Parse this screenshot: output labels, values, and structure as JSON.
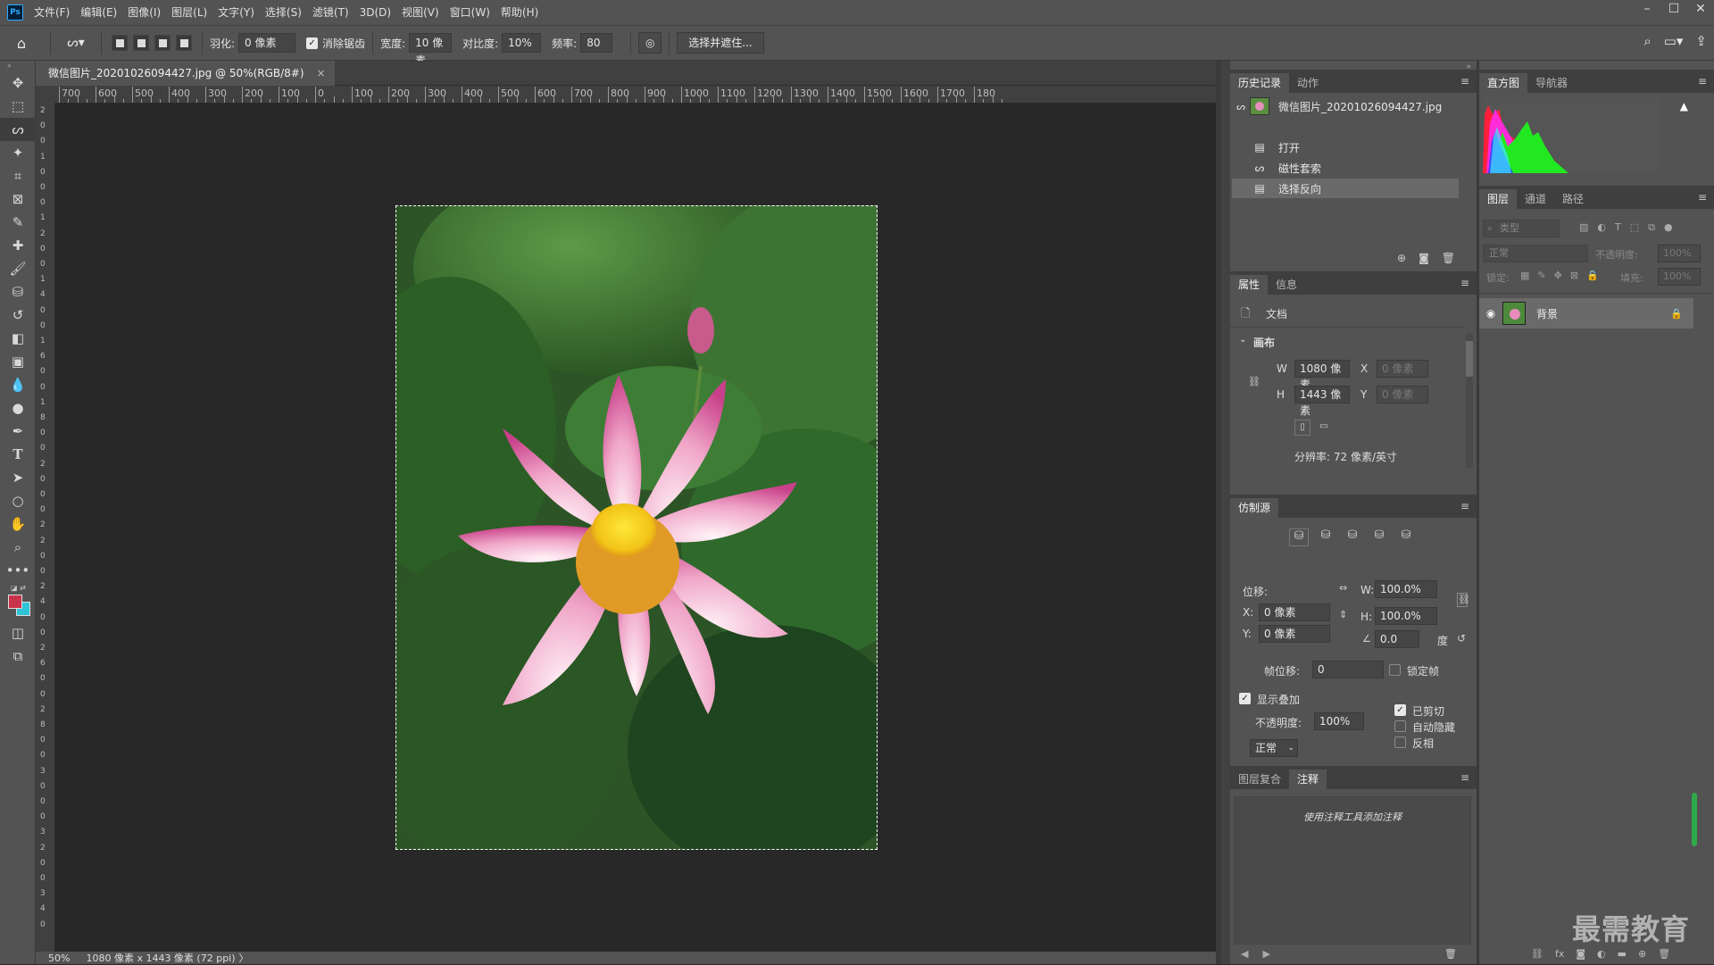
{
  "app": {
    "logo": "Ps"
  },
  "menu": [
    "文件(F)",
    "编辑(E)",
    "图像(I)",
    "图层(L)",
    "文字(Y)",
    "选择(S)",
    "滤镜(T)",
    "3D(D)",
    "视图(V)",
    "窗口(W)",
    "帮助(H)"
  ],
  "options": {
    "feather_label": "羽化:",
    "feather_value": "0 像素",
    "antialias_label": "消除锯齿",
    "width_label": "宽度:",
    "width_value": "10 像素",
    "contrast_label": "对比度:",
    "contrast_value": "10%",
    "frequency_label": "频率:",
    "frequency_value": "80",
    "select_mask_button": "选择并遮住..."
  },
  "document": {
    "tab_title": "微信图片_20201026094427.jpg @ 50%(RGB/8#)",
    "close": "×",
    "status_zoom": "50%",
    "status_info": "1080 像素 x 1443 像素 (72 ppi)",
    "status_more": "〉"
  },
  "ruler_top": [
    "700",
    "600",
    "500",
    "400",
    "300",
    "200",
    "100",
    "0",
    "100",
    "200",
    "300",
    "400",
    "500",
    "600",
    "700",
    "800",
    "900",
    "1000",
    "1100",
    "1200",
    "1300",
    "1400",
    "1500",
    "1600",
    "1700",
    "180"
  ],
  "ruler_left": [
    "2",
    "0",
    "0",
    "1",
    "0",
    "0",
    "0",
    "1",
    "2",
    "0",
    "0",
    "1",
    "4",
    "0",
    "0",
    "1",
    "6",
    "0",
    "0",
    "1",
    "8",
    "0",
    "0",
    "2",
    "0",
    "0",
    "0",
    "2",
    "2",
    "0",
    "0",
    "2",
    "4",
    "0",
    "0",
    "2",
    "6",
    "0",
    "0",
    "2",
    "8",
    "0",
    "0",
    "3",
    "0",
    "0",
    "0",
    "3",
    "2",
    "0",
    "0",
    "3",
    "4",
    "0"
  ],
  "history": {
    "tabs": [
      "历史记录",
      "动作"
    ],
    "snapshot": "微信图片_20201026094427.jpg",
    "items": [
      "打开",
      "磁性套索",
      "选择反向"
    ]
  },
  "properties": {
    "tabs": [
      "属性",
      "信息"
    ],
    "doc_label": "文档",
    "canvas_section": "画布",
    "w_label": "W",
    "w_value": "1080 像素",
    "h_label": "H",
    "h_value": "1443 像素",
    "x_label": "X",
    "x_value": "0 像素",
    "y_label": "Y",
    "y_value": "0 像素",
    "resolution": "分辨率: 72 像素/英寸"
  },
  "clone_source": {
    "tab": "仿制源",
    "offset_label": "位移:",
    "x_label": "X:",
    "x_value": "0 像素",
    "y_label": "Y:",
    "y_value": "0 像素",
    "w_label": "W:",
    "w_value": "100.0%",
    "h_label": "H:",
    "h_value": "100.0%",
    "angle_value": "0.0",
    "angle_unit": "度",
    "frame_offset_label": "帧位移:",
    "frame_offset_value": "0",
    "lock_frame": "锁定帧",
    "show_overlay": "显示叠加",
    "opacity_label": "不透明度:",
    "opacity_value": "100%",
    "clipped": "已剪切",
    "auto_hide": "自动隐藏",
    "invert": "反相",
    "blend_mode": "正常"
  },
  "notes": {
    "tabs": [
      "图层复合",
      "注释"
    ],
    "hint": "使用注释工具添加注释"
  },
  "histogram": {
    "tabs": [
      "直方图",
      "导航器"
    ],
    "warning": "▲"
  },
  "layers": {
    "tabs": [
      "图层",
      "通道",
      "路径"
    ],
    "filter_placeholder": "类型",
    "blend_mode": "正常",
    "opacity_label": "不透明度:",
    "opacity_value": "100%",
    "lock_label": "锁定:",
    "fill_label": "填充:",
    "fill_value": "100%",
    "items": [
      {
        "name": "背景"
      }
    ]
  },
  "watermark": "最需教育",
  "colors": {
    "foreground": "#c8324a",
    "background": "#2fc4d6",
    "accent": "#31a8ff"
  }
}
